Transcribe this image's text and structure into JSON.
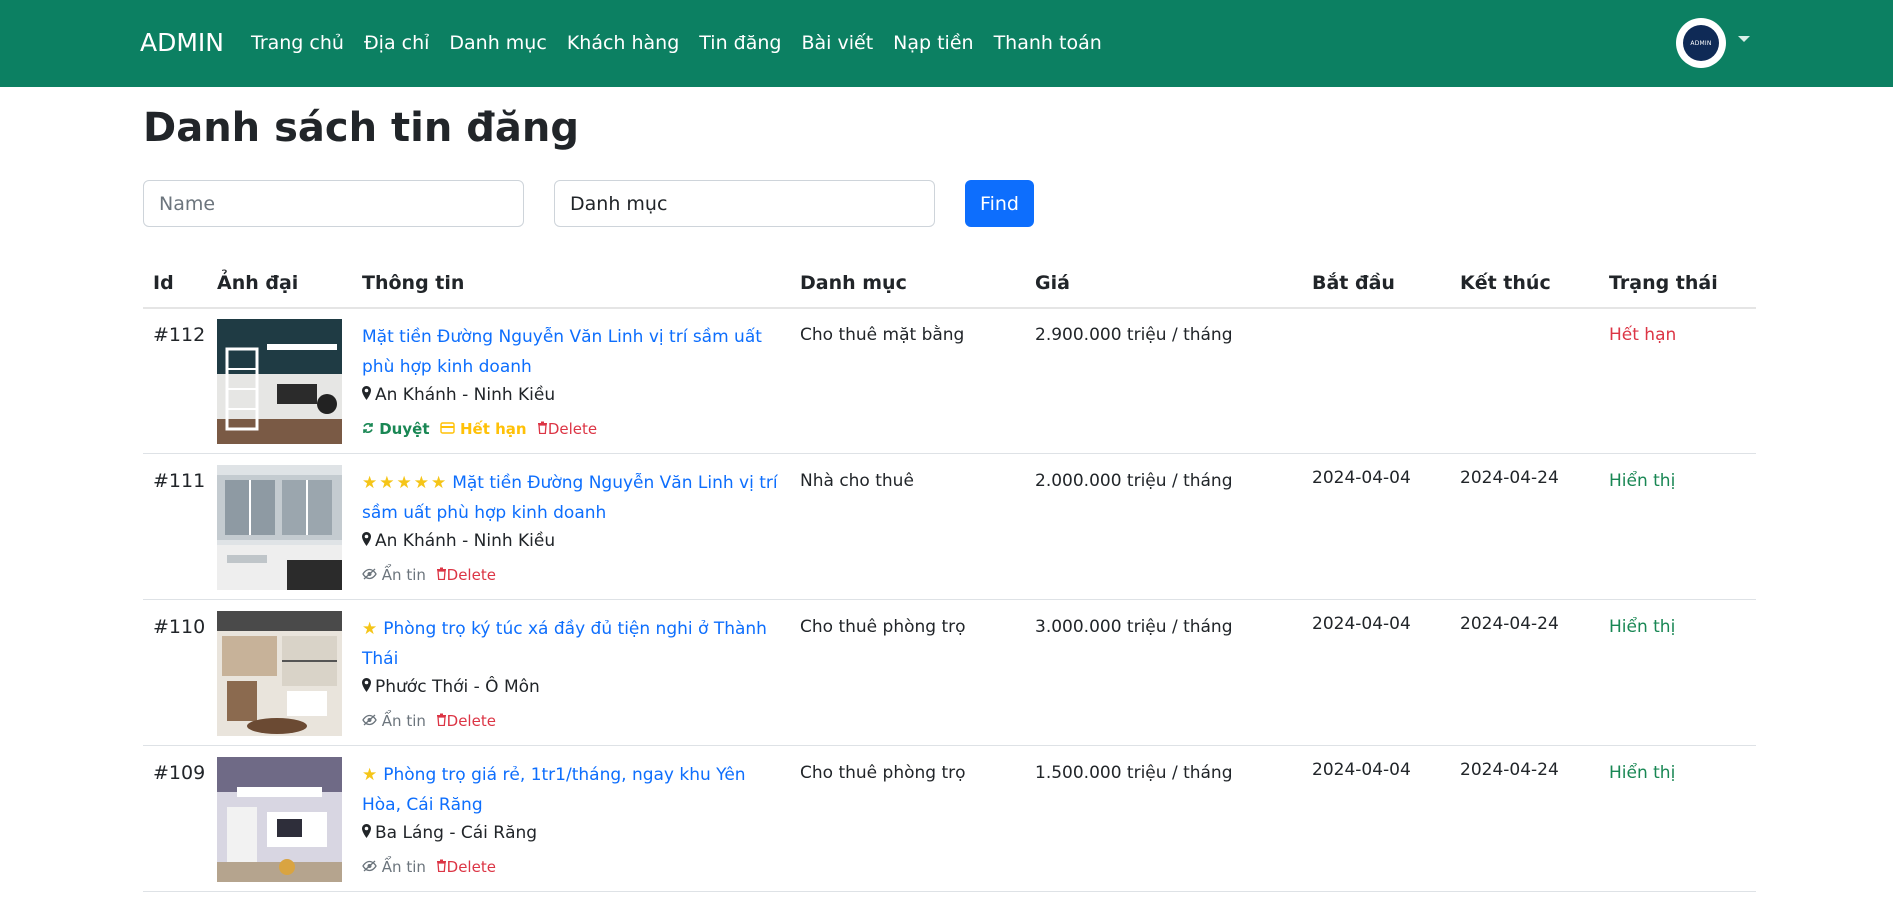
{
  "navbar": {
    "brand": "ADMIN",
    "links": [
      "Trang chủ",
      "Địa chỉ",
      "Danh mục",
      "Khách hàng",
      "Tin đăng",
      "Bài viết",
      "Nạp tiền",
      "Thanh toán"
    ],
    "avatar_text": "ADMIN",
    "bg_color": "#0c8062"
  },
  "page": {
    "title": "Danh sách tin đăng"
  },
  "search": {
    "name_placeholder": "Name",
    "category_value": "Danh mục",
    "find_label": "Find"
  },
  "table": {
    "headers": {
      "id": "Id",
      "image": "Ảnh đại",
      "info": "Thông tin",
      "category": "Danh mục",
      "price": "Giá",
      "start": "Bắt đầu",
      "end": "Kết thúc",
      "status": "Trạng thái"
    },
    "rows": [
      {
        "id": "#112",
        "stars": "",
        "title": "Mặt tiền Đường Nguyễn Văn Linh vị trí sầm uất phù hợp kinh doanh",
        "location": "An Khánh - Ninh Kiều",
        "actions": {
          "approve": "Duyệt",
          "expire": "Hết hạn",
          "delete": "Delete"
        },
        "category": "Cho thuê mặt bằng",
        "price": "2.900.000 triệu / tháng",
        "start": "",
        "end": "",
        "status": "Hết hạn"
      },
      {
        "id": "#111",
        "stars": "★★★★★",
        "title": "Mặt tiền Đường Nguyễn Văn Linh vị trí sầm uất phù hợp kinh doanh",
        "location": "An Khánh - Ninh Kiều",
        "actions": {
          "hide": "Ẩn tin",
          "delete": "Delete"
        },
        "category": "Nhà cho thuê",
        "price": "2.000.000 triệu / tháng",
        "start": "2024-04-04",
        "end": "2024-04-24",
        "status": "Hiển thị"
      },
      {
        "id": "#110",
        "stars": "★",
        "title": "Phòng trọ ký túc xá đầy đủ tiện nghi ở Thành Thái",
        "location": "Phước Thới - Ô Môn",
        "actions": {
          "hide": "Ẩn tin",
          "delete": "Delete"
        },
        "category": "Cho thuê phòng trọ",
        "price": "3.000.000 triệu / tháng",
        "start": "2024-04-04",
        "end": "2024-04-24",
        "status": "Hiển thị"
      },
      {
        "id": "#109",
        "stars": "★",
        "title": "Phòng trọ giá rẻ, 1tr1/tháng, ngay khu Yên Hòa, Cái Răng",
        "location": "Ba Láng - Cái Răng",
        "actions": {
          "hide": "Ẩn tin",
          "delete": "Delete"
        },
        "category": "Cho thuê phòng trọ",
        "price": "1.500.000 triệu / tháng",
        "start": "2024-04-04",
        "end": "2024-04-24",
        "status": "Hiển thị"
      }
    ]
  }
}
